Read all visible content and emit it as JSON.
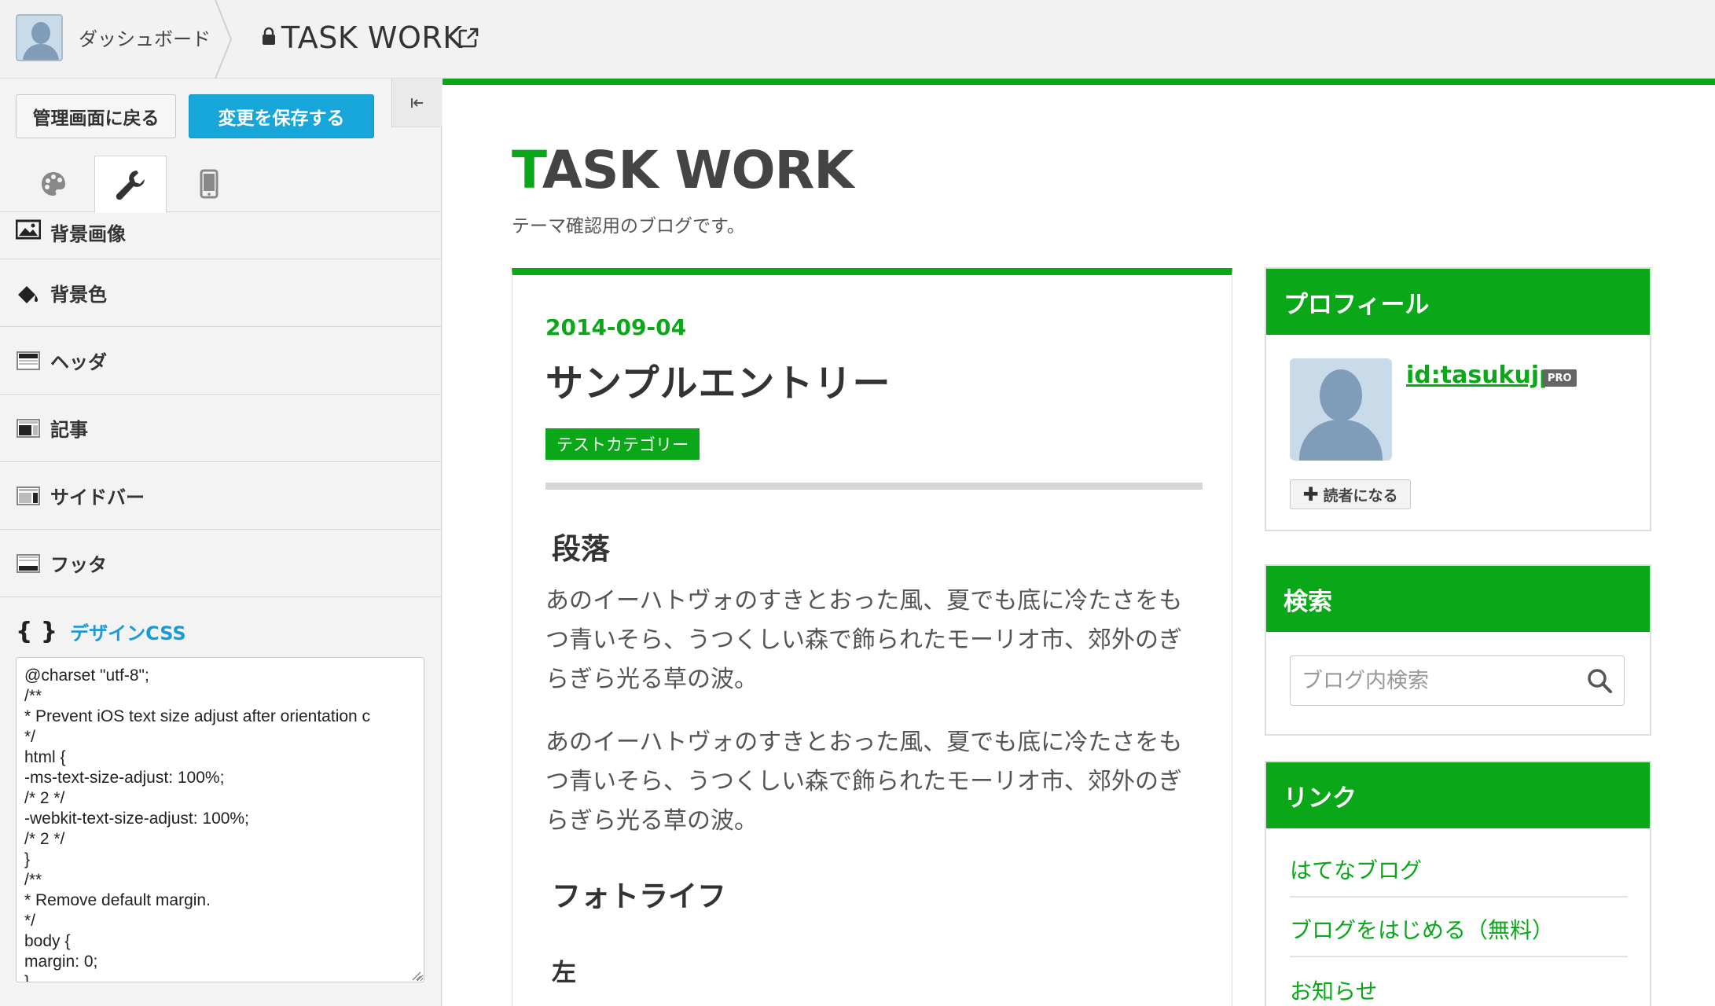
{
  "topbar": {
    "dashboard_label": "ダッシュボード",
    "blog_title": "TASK WORK"
  },
  "left_panel": {
    "back_button": "管理画面に戻る",
    "save_button": "変更を保存する",
    "tabs": [
      "palette-icon",
      "wrench-icon",
      "smartphone-icon"
    ],
    "active_tab": "wrench-icon",
    "menu": {
      "background_image": "背景画像",
      "background_color": "背景色",
      "header": "ヘッダ",
      "article": "記事",
      "sidebar": "サイドバー",
      "footer": "フッタ",
      "design_css": "デザインCSS"
    },
    "css_code": "@charset \"utf-8\";\n/**\n* Prevent iOS text size adjust after orientation c\n*/\nhtml {\n-ms-text-size-adjust: 100%;\n/* 2 */\n-webkit-text-size-adjust: 100%;\n/* 2 */\n}\n/**\n* Remove default margin.\n*/\nbody {\nmargin: 0;\n}"
  },
  "preview": {
    "site_title_first": "T",
    "site_title_rest": "ASK WORK",
    "site_description": "テーマ確認用のブログです。",
    "accent_color": "#0aa818",
    "article": {
      "date": "2014-09-04",
      "title": "サンプルエントリー",
      "category": "テストカテゴリー",
      "h2_paragraph": "段落",
      "paragraph_1": "あのイーハトヴォのすきとおった風、夏でも底に冷たさをもつ青いそら、うつくしい森で飾られたモーリオ市、郊外のぎらぎら光る草の波。",
      "paragraph_2": "あのイーハトヴォのすきとおった風、夏でも底に冷たさをもつ青いそら、うつくしい森で飾られたモーリオ市、郊外のぎらぎら光る草の波。",
      "h2_photo": "フォトライフ",
      "h3_left": "左"
    },
    "sidebar": {
      "profile": {
        "heading": "プロフィール",
        "user_id": "id:tasukujp",
        "badge": "PRO",
        "follow_button": "読者になる"
      },
      "search": {
        "heading": "検索",
        "placeholder": "ブログ内検索"
      },
      "links": {
        "heading": "リンク",
        "items": [
          "はてなブログ",
          "ブログをはじめる（無料）",
          "お知らせ"
        ]
      }
    }
  }
}
